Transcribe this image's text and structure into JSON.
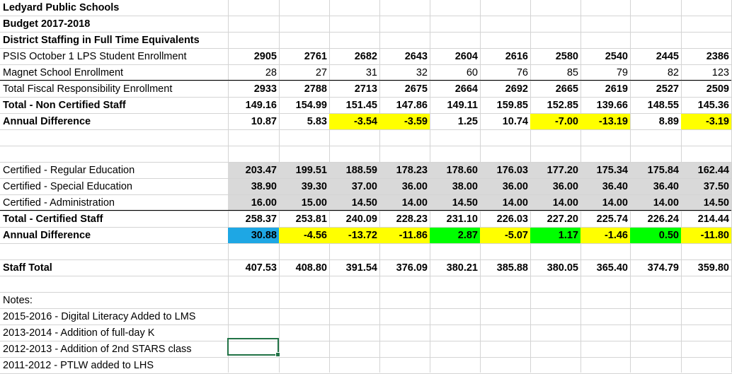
{
  "title_lines": [
    "Ledyard Public Schools",
    "Budget 2017-2018",
    "District Staffing  in Full Time Equivalents"
  ],
  "enrollment_rows": [
    {
      "label": "PSIS October 1 LPS Student Enrollment",
      "bold": false,
      "values": [
        "2905",
        "2761",
        "2682",
        "2643",
        "2604",
        "2616",
        "2580",
        "2540",
        "2445",
        "2386"
      ]
    },
    {
      "label": "Magnet School Enrollment",
      "bold": false,
      "values": [
        "28",
        "27",
        "31",
        "32",
        "60",
        "76",
        "85",
        "79",
        "82",
        "123"
      ]
    },
    {
      "label": "Total Fiscal Responsibility Enrollment",
      "bold": false,
      "values": [
        "2933",
        "2788",
        "2713",
        "2675",
        "2664",
        "2692",
        "2665",
        "2619",
        "2527",
        "2509"
      ]
    },
    {
      "label": "Total - Non Certified Staff",
      "bold": true,
      "values": [
        "149.16",
        "154.99",
        "151.45",
        "147.86",
        "149.11",
        "159.85",
        "152.85",
        "139.66",
        "148.55",
        "145.36"
      ]
    },
    {
      "label": "Annual Difference",
      "bold": true,
      "values": [
        "10.87",
        "5.83",
        "-3.54",
        "-3.59",
        "1.25",
        "10.74",
        "-7.00",
        "-13.19",
        "8.89",
        "-3.19"
      ]
    }
  ],
  "certified_rows": [
    {
      "label": "Certified - Regular Education",
      "bold": false,
      "values": [
        "203.47",
        "199.51",
        "188.59",
        "178.23",
        "178.60",
        "176.03",
        "177.20",
        "175.34",
        "175.84",
        "162.44"
      ]
    },
    {
      "label": "Certified - Special Education",
      "bold": false,
      "values": [
        "38.90",
        "39.30",
        "37.00",
        "36.00",
        "38.00",
        "36.00",
        "36.00",
        "36.40",
        "36.40",
        "37.50"
      ]
    },
    {
      "label": "Certified - Administration",
      "bold": false,
      "values": [
        "16.00",
        "15.00",
        "14.50",
        "14.00",
        "14.50",
        "14.00",
        "14.00",
        "14.00",
        "14.00",
        "14.50"
      ]
    },
    {
      "label": "Total - Certified Staff",
      "bold": true,
      "values": [
        "258.37",
        "253.81",
        "240.09",
        "228.23",
        "231.10",
        "226.03",
        "227.20",
        "225.74",
        "226.24",
        "214.44"
      ]
    },
    {
      "label": "Annual Difference",
      "bold": true,
      "values": [
        "30.88",
        "-4.56",
        "-13.72",
        "-11.86",
        "2.87",
        "-5.07",
        "1.17",
        "-1.46",
        "0.50",
        "-11.80"
      ]
    }
  ],
  "staff_total": {
    "label": "Staff Total",
    "values": [
      "407.53",
      "408.80",
      "391.54",
      "376.09",
      "380.21",
      "385.88",
      "380.05",
      "365.40",
      "374.79",
      "359.80"
    ]
  },
  "notes": [
    "Notes:",
    "2015-2016 - Digital Literacy Added to LMS",
    "2013-2014 - Addition of full-day K",
    "2012-2013 - Addition of 2nd STARS class",
    "2011-2012 - PTLW added to LHS"
  ],
  "colors": {
    "gray_fill": "#d9d9d9",
    "yellow_fill": "#ffff00",
    "green_fill": "#00ff00",
    "blue_fill": "#1ea7e4",
    "selection_border": "#217346"
  }
}
